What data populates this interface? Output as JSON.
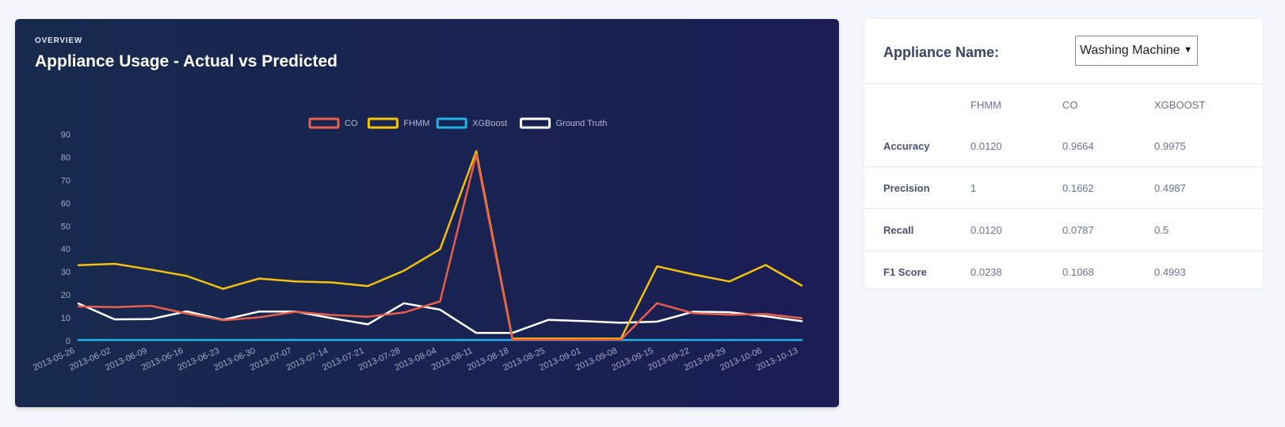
{
  "card": {
    "eyebrow": "OVERVIEW",
    "title": "Appliance Usage - Actual vs Predicted"
  },
  "chart_data": {
    "type": "line",
    "title": "",
    "xlabel": "",
    "ylabel": "",
    "ylim": [
      0,
      90
    ],
    "yticks": [
      0,
      10,
      20,
      30,
      40,
      50,
      60,
      70,
      80,
      90
    ],
    "grid": false,
    "legend_position": "top-center",
    "x": [
      "2013-05-26",
      "2013-06-02",
      "2013-06-09",
      "2013-06-16",
      "2013-06-23",
      "2013-06-30",
      "2013-07-07",
      "2013-07-14",
      "2013-07-21",
      "2013-07-28",
      "2013-08-04",
      "2013-08-11",
      "2013-08-18",
      "2013-08-25",
      "2013-09-01",
      "2013-09-08",
      "2013-09-15",
      "2013-09-22",
      "2013-09-29",
      "2013-10-06",
      "2013-10-13"
    ],
    "series": [
      {
        "name": "CO",
        "color": "#e8604c",
        "values": [
          14.9,
          14.6,
          15.2,
          11.8,
          8.9,
          10.2,
          12.6,
          11.2,
          10.4,
          12.3,
          17.1,
          81.2,
          0.4,
          0.4,
          0.4,
          0.4,
          16.3,
          12.0,
          11.3,
          11.6,
          9.8
        ]
      },
      {
        "name": "FHMM",
        "color": "#f4c20d",
        "values": [
          32.9,
          33.5,
          31.0,
          28.2,
          22.6,
          27.1,
          25.8,
          25.4,
          23.8,
          30.5,
          39.9,
          82.6,
          0.9,
          0.9,
          0.9,
          0.9,
          32.4,
          28.9,
          25.8,
          33.0,
          24.0
        ]
      },
      {
        "name": "XGBoost",
        "color": "#1fb3e8",
        "values": [
          0.3,
          0.3,
          0.3,
          0.3,
          0.3,
          0.3,
          0.3,
          0.3,
          0.3,
          0.3,
          0.3,
          0.3,
          0.3,
          0.3,
          0.3,
          0.3,
          0.3,
          0.3,
          0.3,
          0.3,
          0.3
        ]
      },
      {
        "name": "Ground Truth",
        "color": "#ffffff",
        "values": [
          16.2,
          9.3,
          9.4,
          12.8,
          9.1,
          12.7,
          12.7,
          9.8,
          7.1,
          16.3,
          13.5,
          3.4,
          3.4,
          9.1,
          8.5,
          7.8,
          8.3,
          12.6,
          12.4,
          10.6,
          8.5
        ]
      }
    ]
  },
  "panel": {
    "appliance_label": "Appliance Name:",
    "appliance_value": "Washing Machine",
    "columns": [
      "",
      "FHMM",
      "CO",
      "XGBOOST"
    ],
    "rows": [
      {
        "label": "Accuracy",
        "values": [
          "0.0120",
          "0.9664",
          "0.9975"
        ]
      },
      {
        "label": "Precision",
        "values": [
          "1",
          "0.1662",
          "0.4987"
        ]
      },
      {
        "label": "Recall",
        "values": [
          "0.0120",
          "0.0787",
          "0.5"
        ]
      },
      {
        "label": "F1 Score",
        "values": [
          "0.0238",
          "0.1068",
          "0.4993"
        ]
      }
    ]
  }
}
